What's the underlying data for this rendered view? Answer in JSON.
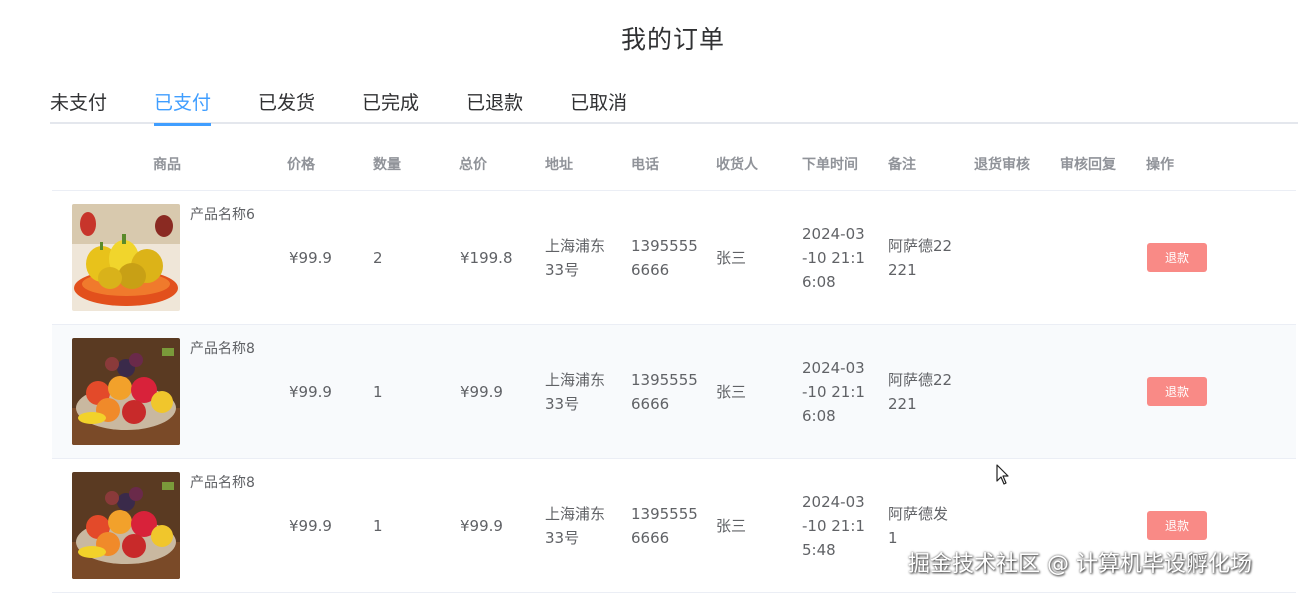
{
  "page": {
    "title": "我的订单"
  },
  "tabs": [
    {
      "label": "未支付",
      "active": false
    },
    {
      "label": "已支付",
      "active": true
    },
    {
      "label": "已发货",
      "active": false
    },
    {
      "label": "已完成",
      "active": false
    },
    {
      "label": "已退款",
      "active": false
    },
    {
      "label": "已取消",
      "active": false
    }
  ],
  "table": {
    "headers": {
      "product": "商品",
      "price": "价格",
      "quantity": "数量",
      "total": "总价",
      "address": "地址",
      "phone": "电话",
      "receiver": "收货人",
      "order_time": "下单时间",
      "remark": "备注",
      "refund_review": "退货审核",
      "review_reply": "审核回复",
      "action": "操作"
    },
    "rows": [
      {
        "product_name": "产品名称6",
        "image": "peppers-basket-image",
        "price": "¥99.9",
        "quantity": "2",
        "total": "¥199.8",
        "address_line1": "上海浦东",
        "address_line2": "33号",
        "phone_line1": "1395555",
        "phone_line2": "6666",
        "receiver": "张三",
        "time_line1": "2024-03",
        "time_line2": "-10 21:1",
        "time_line3": "6:08",
        "remark_line1": "阿萨德22",
        "remark_line2": "221",
        "refund_review": "",
        "review_reply": "",
        "action_label": "退款"
      },
      {
        "product_name": "产品名称8",
        "image": "fruit-plate-image",
        "price": "¥99.9",
        "quantity": "1",
        "total": "¥99.9",
        "address_line1": "上海浦东",
        "address_line2": "33号",
        "phone_line1": "1395555",
        "phone_line2": "6666",
        "receiver": "张三",
        "time_line1": "2024-03",
        "time_line2": "-10 21:1",
        "time_line3": "6:08",
        "remark_line1": "阿萨德22",
        "remark_line2": "221",
        "refund_review": "",
        "review_reply": "",
        "action_label": "退款"
      },
      {
        "product_name": "产品名称8",
        "image": "fruit-plate-image",
        "price": "¥99.9",
        "quantity": "1",
        "total": "¥99.9",
        "address_line1": "上海浦东",
        "address_line2": "33号",
        "phone_line1": "1395555",
        "phone_line2": "6666",
        "receiver": "张三",
        "time_line1": "2024-03",
        "time_line2": "-10 21:1",
        "time_line3": "5:48",
        "remark_line1": "阿萨德发",
        "remark_line2": "1",
        "refund_review": "",
        "review_reply": "",
        "action_label": "退款"
      }
    ]
  },
  "watermark": "掘金技术社区 @ 计算机毕设孵化场",
  "colors": {
    "accent": "#409eff",
    "refund_button": "#f98a86",
    "header_text": "#909399"
  }
}
